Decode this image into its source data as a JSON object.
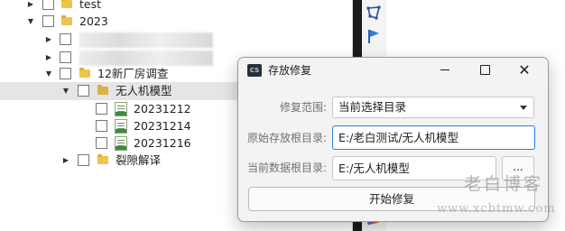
{
  "tree": {
    "items": [
      {
        "label": "test"
      },
      {
        "label": "2023"
      },
      {
        "label": ""
      },
      {
        "label": ""
      },
      {
        "label": "12新厂房调查"
      },
      {
        "label": "无人机模型"
      },
      {
        "label": "20231212"
      },
      {
        "label": "20231214"
      },
      {
        "label": "20231216"
      },
      {
        "label": "裂隙解译"
      }
    ]
  },
  "toolbar": {
    "icons": [
      "polygon-icon",
      "flag-icon"
    ]
  },
  "dialog": {
    "title": "存放修复",
    "app_icon_text": "CS",
    "fields": {
      "scope_label": "修复范围:",
      "scope_value": "当前选择目录",
      "original_label": "原始存放根目录:",
      "original_value": "E:/老白测试/无人机模型",
      "current_label": "当前数据根目录:",
      "current_value": "E:/无人机模型"
    },
    "browse_label": "...",
    "start_label": "开始修复"
  },
  "watermark": {
    "text": "老白博客",
    "url": "www.xcbtmw.com"
  },
  "colors": {
    "accent": "#2f7bd8",
    "folder": "#f0c44c",
    "selected_row": "#e5e5e5"
  }
}
